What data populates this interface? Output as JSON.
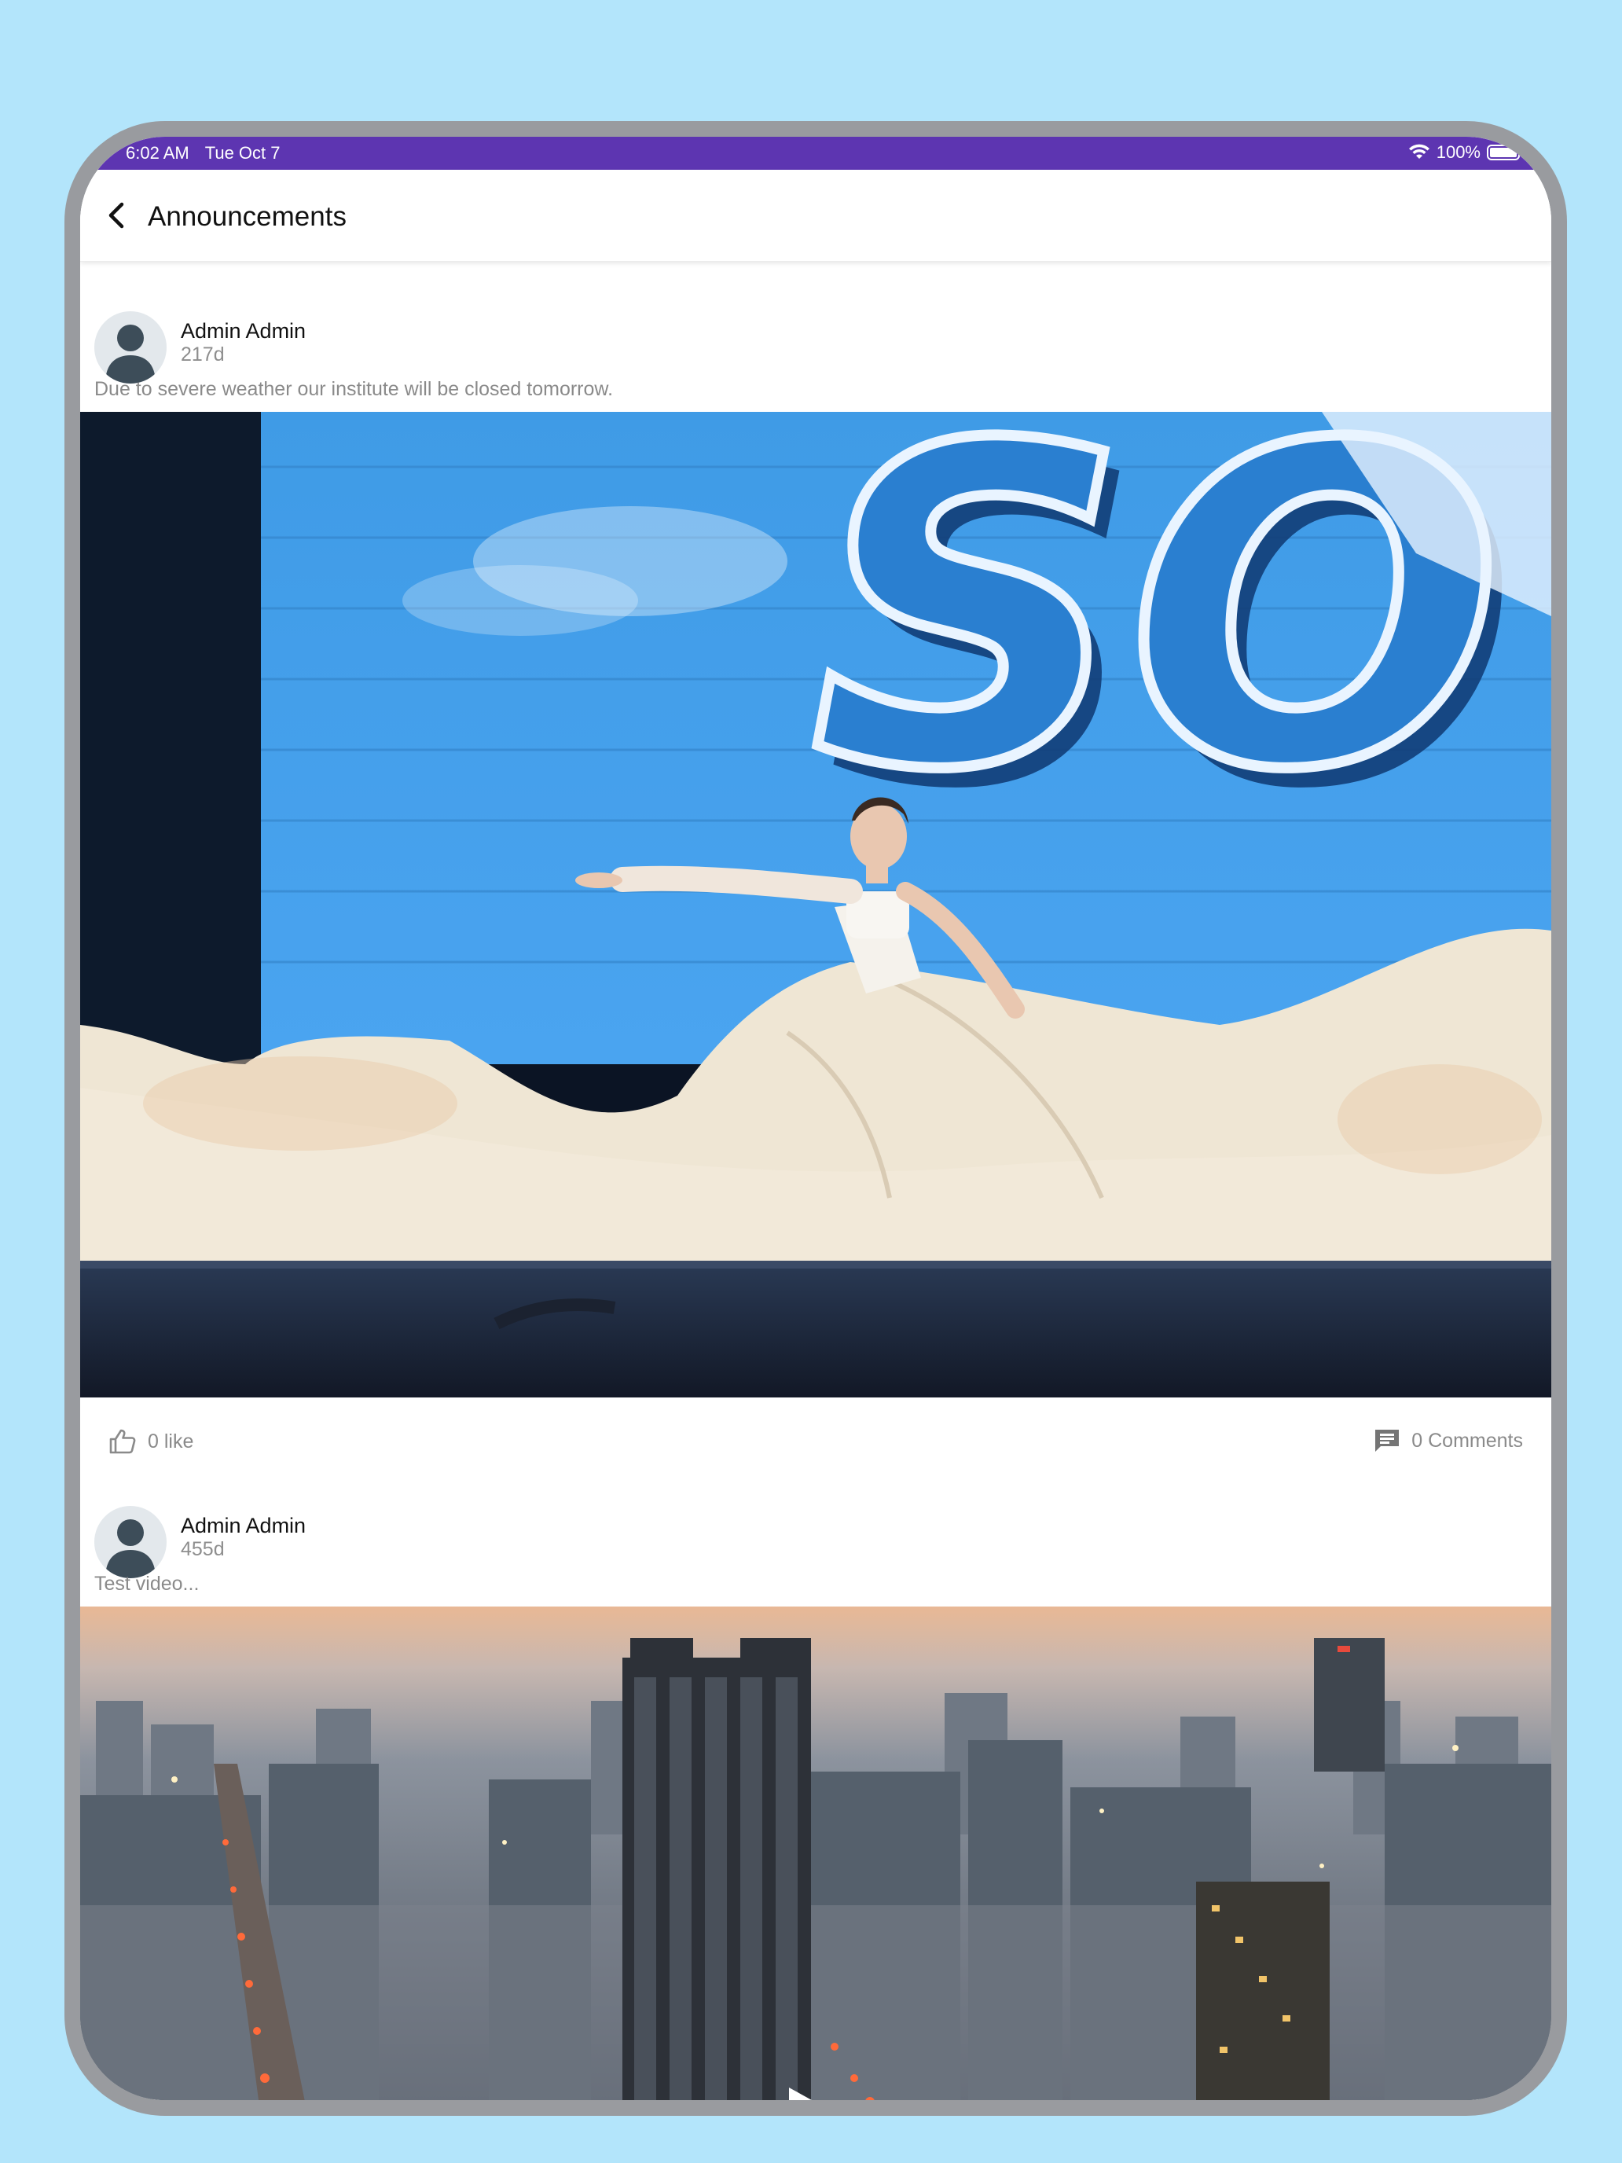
{
  "status_bar": {
    "time": "6:02 AM",
    "date": "Tue Oct 7",
    "battery": "100%",
    "battery_level": 1.0,
    "color": "#5d35b1"
  },
  "header": {
    "back_icon": "chevron-left-icon",
    "title": "Announcements"
  },
  "posts": [
    {
      "author": "Admin Admin",
      "age": "217d",
      "text": "Due to severe weather our institute will be closed tomorrow.",
      "media_type": "image",
      "likes": "0 like",
      "comments": "0 Comments"
    },
    {
      "author": "Admin Admin",
      "age": "455d",
      "text": "Test video...",
      "media_type": "video",
      "play_icon": "play-icon"
    }
  ],
  "colors": {
    "background": "#b3e5fb",
    "frame": "#999b9f",
    "meta_text": "#8a8a8a"
  }
}
